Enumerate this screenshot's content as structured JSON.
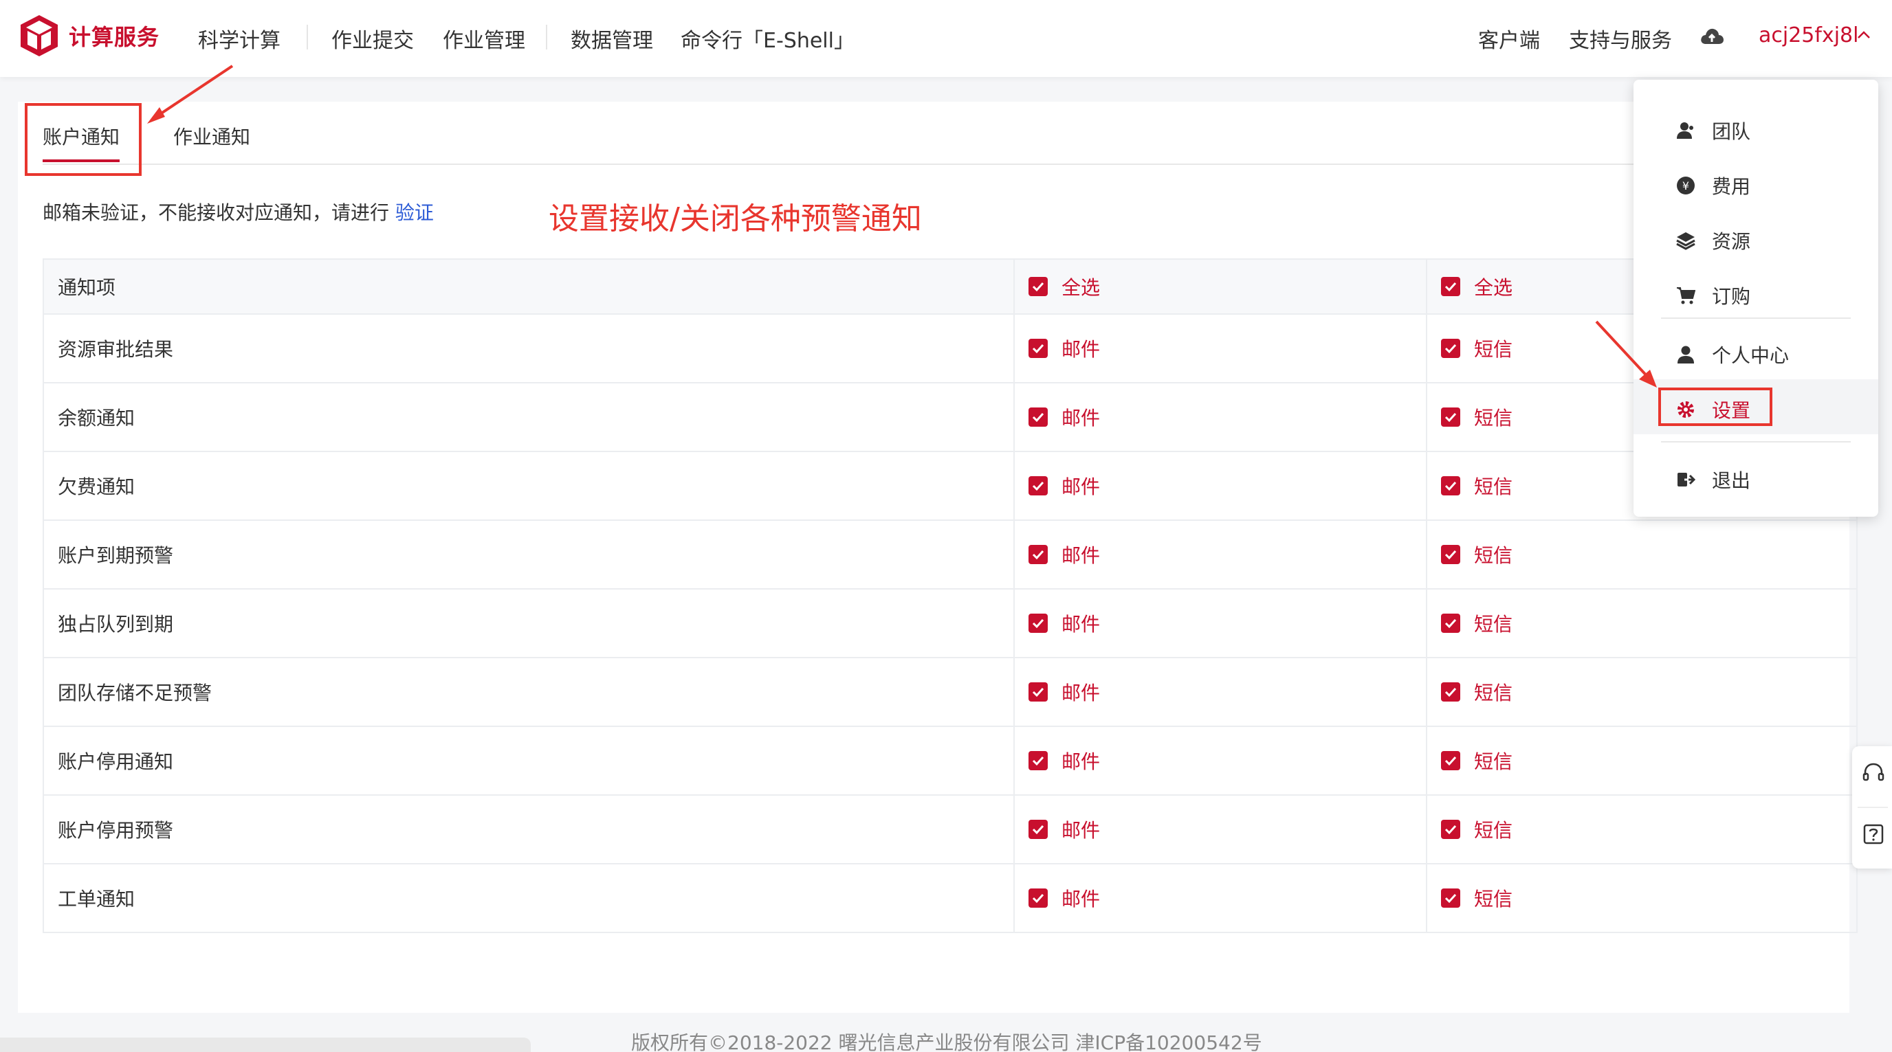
{
  "nav": {
    "brand": "计算服务",
    "items": [
      "科学计算",
      "作业提交",
      "作业管理",
      "数据管理",
      "命令行「E-Shell」"
    ],
    "right": {
      "client": "客户端",
      "support": "支持与服务",
      "user": "acj25fxj8l"
    }
  },
  "tabs": [
    "账户通知",
    "作业通知"
  ],
  "hint": {
    "text": "邮箱未验证，不能接收对应通知，请进行",
    "link": "验证"
  },
  "annotation": "设置接收/关闭各种预警通知",
  "table": {
    "headers": [
      "通知项",
      "全选",
      "全选"
    ],
    "email_label": "邮件",
    "sms_label": "短信",
    "rows": [
      "资源审批结果",
      "余额通知",
      "欠费通知",
      "账户到期预警",
      "独占队列到期",
      "团队存储不足预警",
      "账户停用通知",
      "账户停用预警",
      "工单通知"
    ]
  },
  "dropdown": {
    "items": [
      "团队",
      "费用",
      "资源",
      "订购",
      "个人中心",
      "设置",
      "退出"
    ]
  },
  "footer": "版权所有©2018-2022   曙光信息产业股份有限公司   津ICP备10200542号",
  "colors": {
    "accent": "#c8102e",
    "annotation": "#e8362e",
    "link": "#2c5bd6"
  }
}
